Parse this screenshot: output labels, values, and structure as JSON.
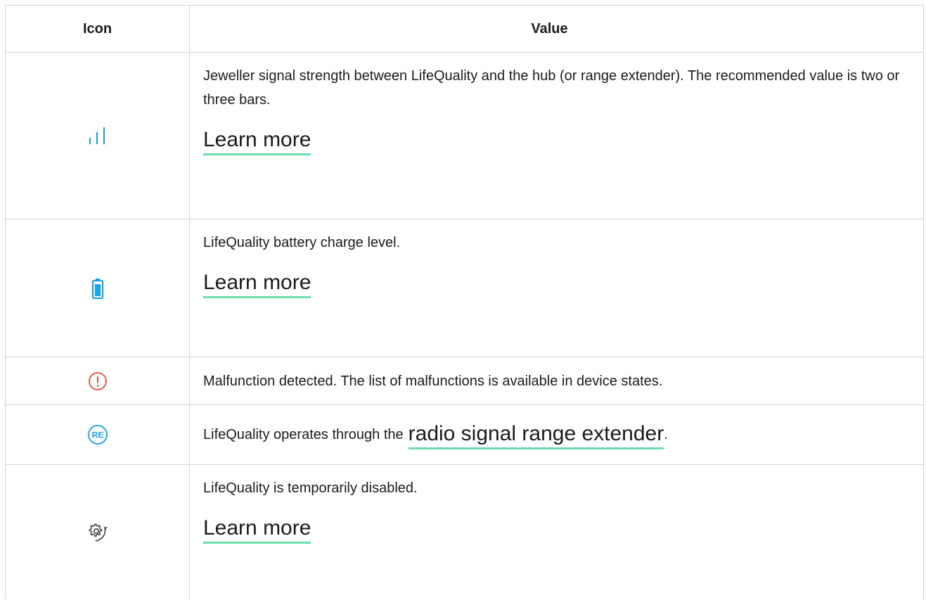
{
  "header": {
    "icon_col": "Icon",
    "value_col": "Value"
  },
  "rows": [
    {
      "icon": "signal-strength-icon",
      "description": "Jeweller signal strength between LifeQuality and the hub (or range extender). The recommended value is two or three bars.",
      "link": "Learn more"
    },
    {
      "icon": "battery-icon",
      "description": "LifeQuality battery charge level.",
      "link": "Learn more"
    },
    {
      "icon": "malfunction-icon",
      "description": "Malfunction detected. The list of malfunctions is available in device states."
    },
    {
      "icon": "range-extender-icon",
      "icon_text": "RE",
      "description_prefix": "LifeQuality operates through the",
      "link": "radio signal range extender",
      "description_suffix": "."
    },
    {
      "icon": "temporarily-disabled-icon",
      "description": "LifeQuality is temporarily disabled.",
      "link": "Learn more"
    }
  ],
  "colors": {
    "accent_blue": "#1aa3e8",
    "alert_red": "#e8503a",
    "link_underline": "#6fdcae",
    "border": "#d4d4d4"
  }
}
